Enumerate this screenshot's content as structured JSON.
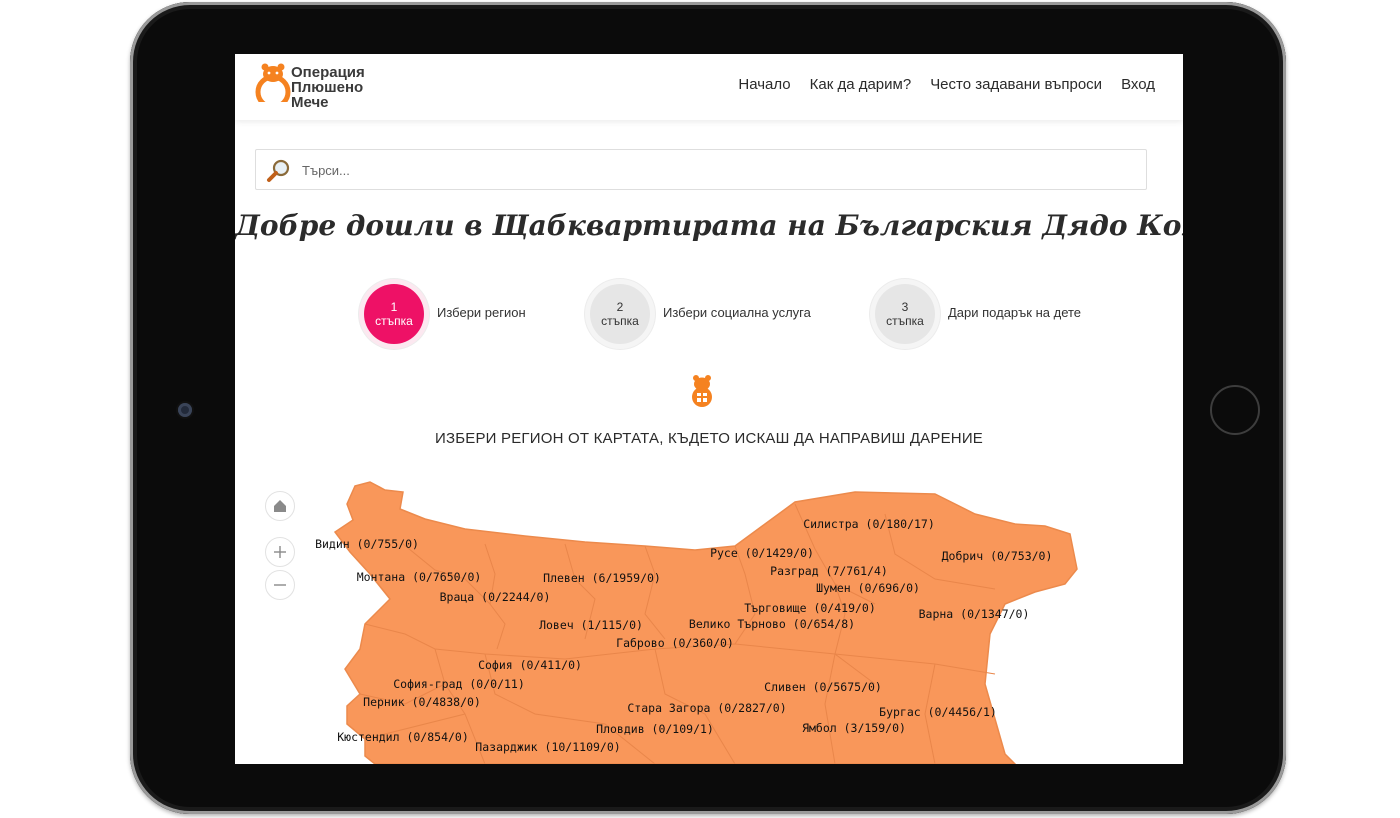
{
  "brand": {
    "line1": "Операция",
    "line2": "Плюшено",
    "line3": "Мече",
    "accent_color": "#f58220"
  },
  "nav": {
    "items": [
      "Начало",
      "Как да дарим?",
      "Често задавани въпроси",
      "Вход"
    ]
  },
  "search": {
    "placeholder": "Търси...",
    "icon": "magnifier-icon"
  },
  "page_title": "Добре дошли в Щабквартирата на Българския Дядо Коледа",
  "steps": [
    {
      "number": "1",
      "unit": "стъпка",
      "label": "Избери регион",
      "active": true
    },
    {
      "number": "2",
      "unit": "стъпка",
      "label": "Избери социална услуга",
      "active": false
    },
    {
      "number": "3",
      "unit": "стъпка",
      "label": "Дари подарък на дете",
      "active": false
    }
  ],
  "map_heading": "ИЗБЕРИ РЕГИОН ОТ КАРТАТА, КЪДЕТО ИСКАШ ДА НАПРАВИШ ДАРЕНИЕ",
  "map_controls": {
    "home": "home-icon",
    "zoom_in": "plus-icon",
    "zoom_out": "minus-icon"
  },
  "colors": {
    "step_active": "#ee1166",
    "map_fill": "#f9975a",
    "map_border": "#e07f44"
  },
  "regions": [
    {
      "name": "Видин",
      "label": "Видин (0/755/0)"
    },
    {
      "name": "Силистра",
      "label": "Силистра (0/180/17)"
    },
    {
      "name": "Русе",
      "label": "Русе (0/1429/0)"
    },
    {
      "name": "Добрич",
      "label": "Добрич (0/753/0)"
    },
    {
      "name": "Монтана",
      "label": "Монтана (0/7650/0)"
    },
    {
      "name": "Плевен",
      "label": "Плевен (6/1959/0)"
    },
    {
      "name": "Разград",
      "label": "Разград (7/761/4)"
    },
    {
      "name": "Шумен",
      "label": "Шумен (0/696/0)"
    },
    {
      "name": "Враца",
      "label": "Враца (0/2244/0)"
    },
    {
      "name": "Търговище",
      "label": "Търговище (0/419/0)"
    },
    {
      "name": "Варна",
      "label": "Варна (0/1347/0)"
    },
    {
      "name": "Ловеч",
      "label": "Ловеч (1/115/0)"
    },
    {
      "name": "Велико Търново",
      "label": "Велико Търново (0/654/8)"
    },
    {
      "name": "Габрово",
      "label": "Габрово (0/360/0)"
    },
    {
      "name": "София",
      "label": "София (0/411/0)"
    },
    {
      "name": "София-град",
      "label": "София-град (0/0/11)"
    },
    {
      "name": "Сливен",
      "label": "Сливен (0/5675/0)"
    },
    {
      "name": "Перник",
      "label": "Перник (0/4838/0)"
    },
    {
      "name": "Стара Загора",
      "label": "Стара Загора (0/2827/0)"
    },
    {
      "name": "Бургас",
      "label": "Бургас (0/4456/1)"
    },
    {
      "name": "Пловдив",
      "label": "Пловдив (0/109/1)"
    },
    {
      "name": "Ямбол",
      "label": "Ямбол (3/159/0)"
    },
    {
      "name": "Кюстендил",
      "label": "Кюстендил (0/854/0)"
    },
    {
      "name": "Пазарджик",
      "label": "Пазарджик (10/1109/0)"
    }
  ]
}
